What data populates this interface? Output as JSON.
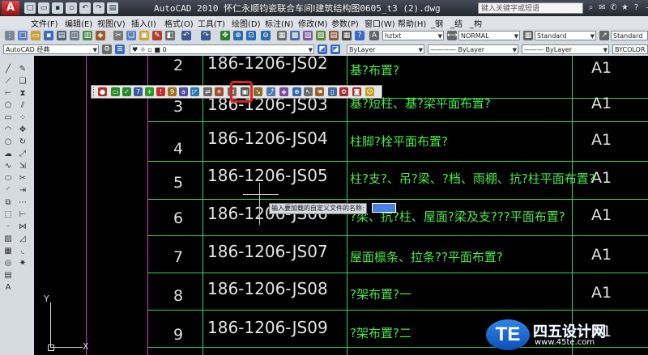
{
  "titlebar": {
    "app_logo": "A",
    "title": "AutoCAD 2010  怀仁永顺钧瓷联合车间Ⅰ建筑结构图0605_t3 (2).dwg",
    "search_placeholder": "键入关键字或短语"
  },
  "menu": [
    "文件(F)",
    "编辑(E)",
    "视图(V)",
    "插入(I)",
    "格式(O)",
    "工具(T)",
    "绘图(D)",
    "标注(N)",
    "修改(M)",
    "参数(P)",
    "窗口(W)",
    "帮助(H)",
    "_钢",
    "_结",
    "_构"
  ],
  "toolbar1": {
    "text_style": "hztxt",
    "dim_style": "NORMAL",
    "table_style": "Standard",
    "ml_style": "Standard"
  },
  "toolbar2": {
    "workspace": "AutoCAD 经典",
    "layer": "0",
    "color": "ByLayer",
    "linetype": "ByLayer",
    "lineweight": "ByLayer",
    "plot_style": "BYCOLOR"
  },
  "table": {
    "rows": [
      {
        "no": "2",
        "code": "186-1206-JS02",
        "desc": "基?布置?",
        "rev": "A1"
      },
      {
        "no": "3",
        "code": "186-1206-JS03",
        "desc": "基?短柱、基?梁平面布置?",
        "rev": "A1"
      },
      {
        "no": "4",
        "code": "186-1206-JS04",
        "desc": "柱脚?栓平面布置?",
        "rev": "A1"
      },
      {
        "no": "5",
        "code": "186-1206-JS05",
        "desc": "柱?支?、吊?梁、?档、雨棚、抗?柱平面布置?",
        "rev": "A1"
      },
      {
        "no": "6",
        "code": "186-1206-JS06",
        "desc": "?梁、抗?柱、屋面?梁及支???平面布置?",
        "rev": "A1"
      },
      {
        "no": "7",
        "code": "186-1206-JS07",
        "desc": "屋面檩条、拉条??平面布置?",
        "rev": "A1"
      },
      {
        "no": "8",
        "code": "186-1206-JS08",
        "desc": "?架布置?一",
        "rev": "A1"
      },
      {
        "no": "9",
        "code": "186-1206-JS09",
        "desc": "?架布置?二",
        "rev": "A1"
      }
    ]
  },
  "prompt": {
    "text": "输入要加载的自定义文件的名称:"
  },
  "ucs": {
    "x": "X",
    "y": "Y"
  },
  "watermark": {
    "logo": "TE",
    "title": "四五设计网",
    "url": "www.45te.com"
  },
  "colors": {
    "title_bg": "#23272e",
    "toolbar_bg": "#d6dbe1",
    "grid_green": "#2fd85a",
    "grid_magenta": "#d633d6",
    "text_green": "#4be94b",
    "highlight_red": "#e0201a",
    "watermark_blue": "#1a63d0"
  }
}
